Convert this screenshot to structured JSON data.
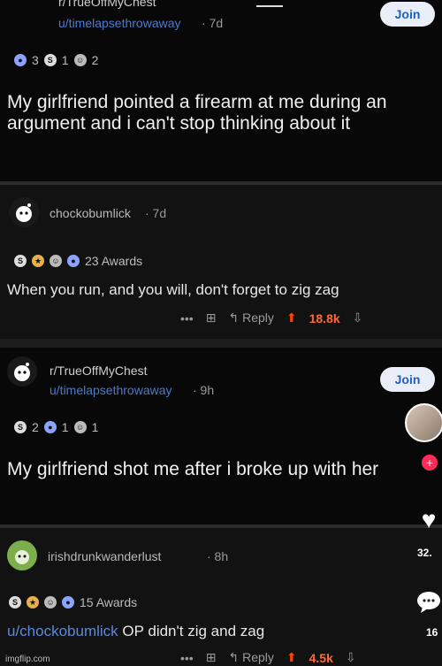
{
  "post1": {
    "subreddit": "r/TrueOffMyChest",
    "user": "u/timelapsethrowaway",
    "age": "· 7d",
    "join_label": "Join",
    "awards": [
      "3",
      "1",
      "2"
    ],
    "title": "My girlfriend pointed a firearm at me during an argument and i can't stop thinking about it"
  },
  "comment1": {
    "user": "chockobumlick",
    "age": "· 7d",
    "awards_label": "23 Awards",
    "text": "When you run, and you will, don't forget to zig zag",
    "more": "•••",
    "reply": "Reply",
    "score": "18.8k"
  },
  "post2": {
    "subreddit": "r/TrueOffMyChest",
    "user": "u/timelapsethrowaway",
    "age": "· 9h",
    "join_label": "Join",
    "awards": [
      "2",
      "1",
      "1"
    ],
    "title": "My girlfriend shot me after i broke up with her"
  },
  "comment2": {
    "user": "irishdrunkwanderlust",
    "age": "· 8h",
    "awards_label": "15 Awards",
    "mention": "u/chockobumlick",
    "text": " OP didn't zig and zag",
    "more": "•••",
    "reply": "Reply",
    "score": "4.5k"
  },
  "sidebar": {
    "likes": "32.",
    "comments": "16"
  },
  "watermark": "imgflip.com"
}
